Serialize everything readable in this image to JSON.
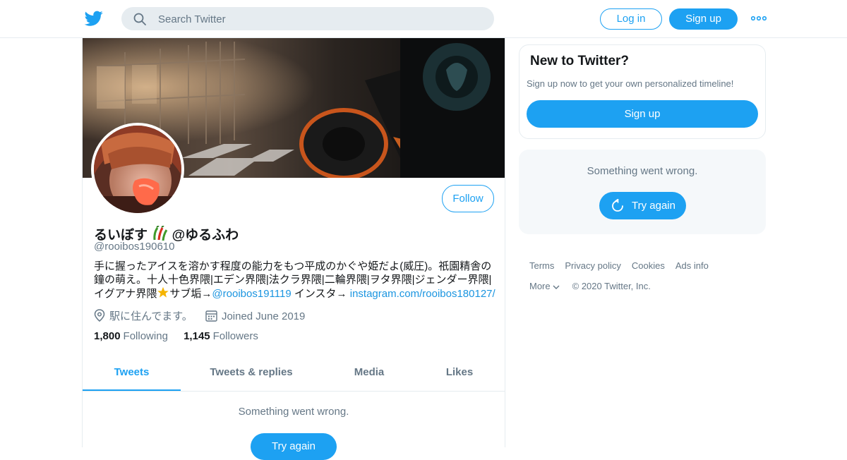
{
  "header": {
    "search_placeholder": "Search Twitter",
    "login_label": "Log in",
    "signup_label": "Sign up",
    "icons": [
      "twitter-bird-icon",
      "search-icon",
      "more-dots-icon"
    ]
  },
  "profile": {
    "name": "るいぼす",
    "name_suffix": "@ゆるふわ",
    "handle": "@rooibos190610",
    "follow_label": "Follow",
    "bio_text": "手に握ったアイスを溶かす程度の能力をもつ平成のかぐや姫だよ(威圧)。祇園精舎の鐘の萌え。十人十色界隈|エデン界隈|法クラ界隈|二輪界隈|ヲタ界隈|ジェンダー界隈|イグアナ界隈",
    "bio_mid": "サブ垢→",
    "bio_mention": "@rooibos191119",
    "bio_insta": " インスタ→ ",
    "bio_link": "instagram.com/rooibos180127/",
    "location": "駅に住んでます。",
    "joined": "Joined June 2019",
    "following_count": "1,800",
    "following_label": "Following",
    "followers_count": "1,145",
    "followers_label": "Followers"
  },
  "tabs": [
    {
      "label": "Tweets",
      "active": true
    },
    {
      "label": "Tweets & replies",
      "active": false
    },
    {
      "label": "Media",
      "active": false
    },
    {
      "label": "Likes",
      "active": false
    }
  ],
  "main_error": {
    "message": "Something went wrong.",
    "retry_label": "Try again"
  },
  "sidebar": {
    "new_title": "New to Twitter?",
    "new_sub": "Sign up now to get your own personalized timeline!",
    "new_button": "Sign up",
    "error_message": "Something went wrong.",
    "retry_label": "Try again"
  },
  "footer": {
    "links": [
      "Terms",
      "Privacy policy",
      "Cookies",
      "Ads info"
    ],
    "more_label": "More",
    "copyright": "© 2020 Twitter, Inc."
  },
  "colors": {
    "accent": "#1da1f2",
    "border": "#e6ecf0",
    "muted_text": "#657786"
  }
}
